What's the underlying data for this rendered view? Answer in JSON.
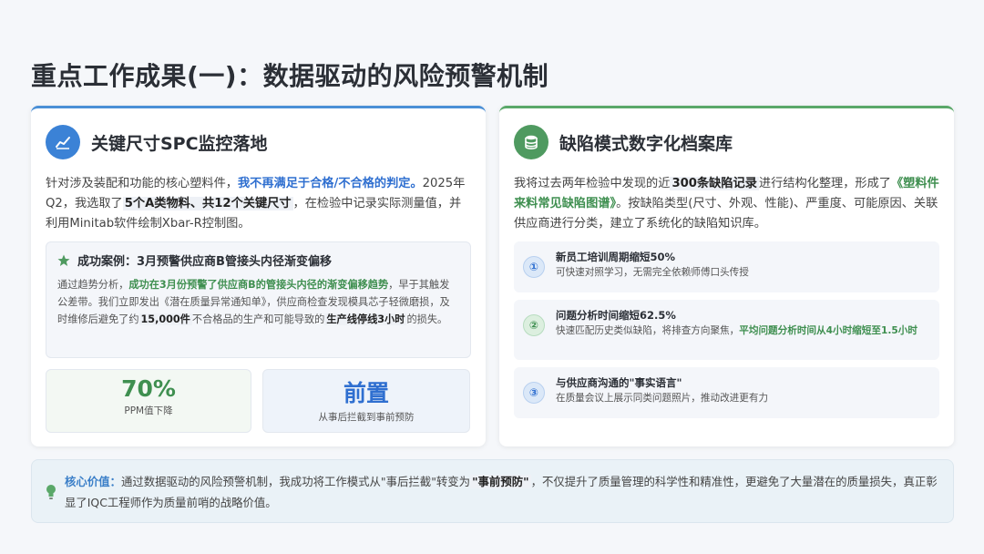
{
  "page_title": "重点工作成果(一)：数据驱动的风险预警机制",
  "left_card": {
    "title": "关键尺寸SPC监控落地",
    "icon": "chart-line-icon",
    "accent": "#4a8fd6",
    "para": {
      "p1": "针对涉及装配和功能的核心塑料件，",
      "p2": "我不再满足于合格/不合格的判定。",
      "p3": "2025年Q2，我选取了",
      "p4": "5个A类物料、共12个关键尺寸",
      "p5": "，在检验中记录实际测量值，并利用Minitab软件绘制Xbar-R控制图。"
    },
    "case": {
      "icon": "star-icon",
      "title": "成功案例：3月预警供应商B管接头内径渐变偏移",
      "t1": "通过趋势分析，",
      "t2": "成功在3月份预警了供应商B的管接头内径的渐变偏移趋势",
      "t3": "，早于其触发公差带。我们立即发出《潜在质量异常通知单》，供应商检查发现模具芯子轻微磨损，及时维修后避免了约",
      "t4": "15,000件",
      "t5": "不合格品的生产和可能导致的",
      "t6": "生产线停线3小时",
      "t7": "的损失。"
    },
    "stats": [
      {
        "value": "70%",
        "caption": "PPM值下降"
      },
      {
        "value": "前置",
        "caption": "从事后拦截到事前预防"
      }
    ]
  },
  "right_card": {
    "title": "缺陷模式数字化档案库",
    "icon": "database-icon",
    "accent": "#5aa869",
    "para": {
      "p1": "我将过去两年检验中发现的近",
      "p2": "300条缺陷记录",
      "p3": "进行结构化整理，形成了",
      "p4": "《塑料件来料常见缺陷图谱》",
      "p5": "。按缺陷类型(尺寸、外观、性能)、严重度、可能原因、关联供应商进行分类，建立了系统化的缺陷知识库。"
    },
    "benefits": [
      {
        "num": "①",
        "title": "新员工培训周期缩短50%",
        "desc": "可快速对照学习，无需完全依赖师傅口头传授",
        "desc_hl": ""
      },
      {
        "num": "②",
        "title": "问题分析时间缩短62.5%",
        "desc": "快速匹配历史类似缺陷，将排查方向聚焦，",
        "desc_hl": "平均问题分析时间从4小时缩短至1.5小时"
      },
      {
        "num": "③",
        "title": "与供应商沟通的\"事实语言\"",
        "desc": "在质量会议上展示同类问题照片，推动改进更有力",
        "desc_hl": ""
      }
    ]
  },
  "bottom_banner": {
    "icon": "lightbulb-icon",
    "label": "核心价值：",
    "t1": "通过数据驱动的风险预警机制，我成功将工作模式从\"事后拦截\"转变为",
    "t2": "\"事前预防\"",
    "t3": "，不仅提升了质量管理的科学性和精准性，更避免了大量潜在的质量损失，真正彰显了IQC工程师作为质量前哨的战略价值。"
  }
}
